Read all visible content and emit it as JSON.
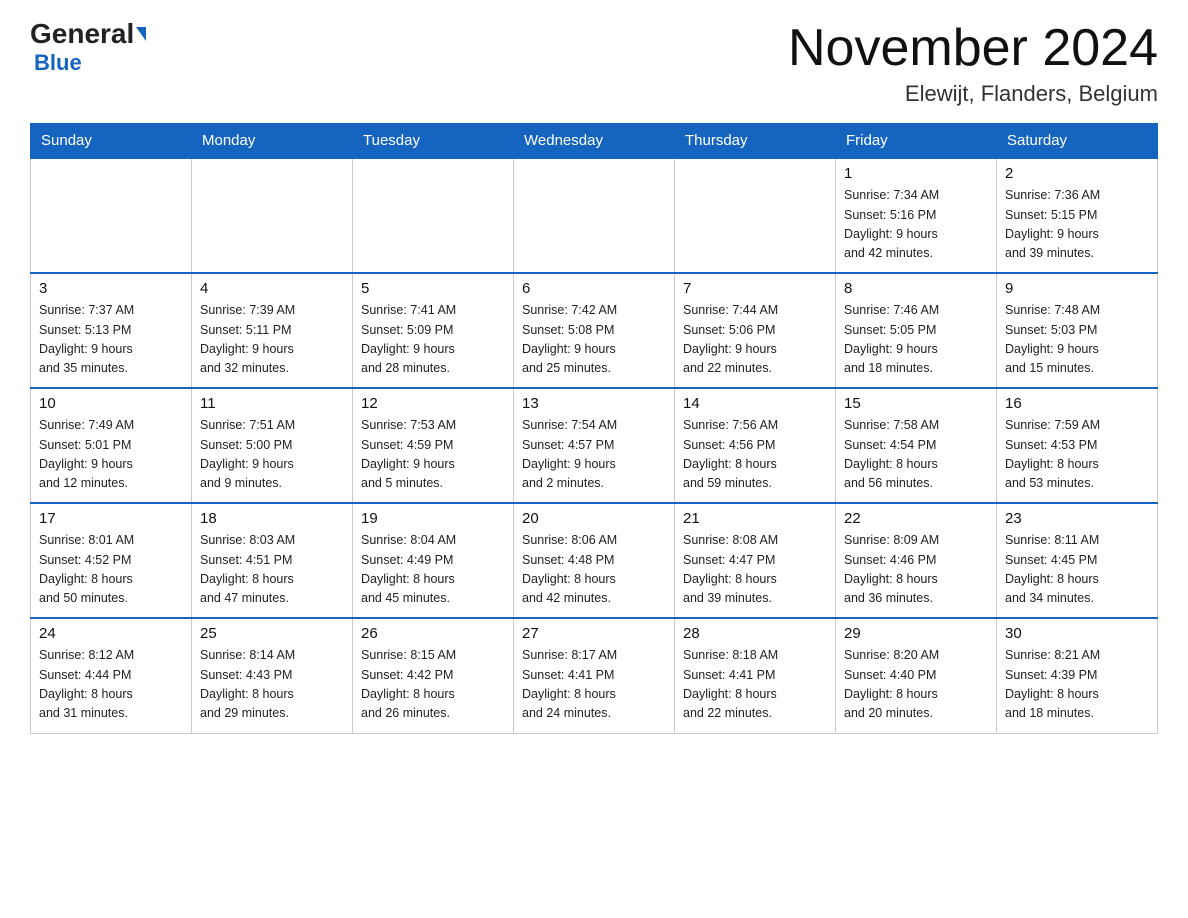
{
  "header": {
    "logo_general": "General",
    "logo_blue": "Blue",
    "month_year": "November 2024",
    "location": "Elewijt, Flanders, Belgium"
  },
  "days_of_week": [
    "Sunday",
    "Monday",
    "Tuesday",
    "Wednesday",
    "Thursday",
    "Friday",
    "Saturday"
  ],
  "weeks": [
    {
      "days": [
        {
          "num": "",
          "info": ""
        },
        {
          "num": "",
          "info": ""
        },
        {
          "num": "",
          "info": ""
        },
        {
          "num": "",
          "info": ""
        },
        {
          "num": "",
          "info": ""
        },
        {
          "num": "1",
          "info": "Sunrise: 7:34 AM\nSunset: 5:16 PM\nDaylight: 9 hours\nand 42 minutes."
        },
        {
          "num": "2",
          "info": "Sunrise: 7:36 AM\nSunset: 5:15 PM\nDaylight: 9 hours\nand 39 minutes."
        }
      ]
    },
    {
      "days": [
        {
          "num": "3",
          "info": "Sunrise: 7:37 AM\nSunset: 5:13 PM\nDaylight: 9 hours\nand 35 minutes."
        },
        {
          "num": "4",
          "info": "Sunrise: 7:39 AM\nSunset: 5:11 PM\nDaylight: 9 hours\nand 32 minutes."
        },
        {
          "num": "5",
          "info": "Sunrise: 7:41 AM\nSunset: 5:09 PM\nDaylight: 9 hours\nand 28 minutes."
        },
        {
          "num": "6",
          "info": "Sunrise: 7:42 AM\nSunset: 5:08 PM\nDaylight: 9 hours\nand 25 minutes."
        },
        {
          "num": "7",
          "info": "Sunrise: 7:44 AM\nSunset: 5:06 PM\nDaylight: 9 hours\nand 22 minutes."
        },
        {
          "num": "8",
          "info": "Sunrise: 7:46 AM\nSunset: 5:05 PM\nDaylight: 9 hours\nand 18 minutes."
        },
        {
          "num": "9",
          "info": "Sunrise: 7:48 AM\nSunset: 5:03 PM\nDaylight: 9 hours\nand 15 minutes."
        }
      ]
    },
    {
      "days": [
        {
          "num": "10",
          "info": "Sunrise: 7:49 AM\nSunset: 5:01 PM\nDaylight: 9 hours\nand 12 minutes."
        },
        {
          "num": "11",
          "info": "Sunrise: 7:51 AM\nSunset: 5:00 PM\nDaylight: 9 hours\nand 9 minutes."
        },
        {
          "num": "12",
          "info": "Sunrise: 7:53 AM\nSunset: 4:59 PM\nDaylight: 9 hours\nand 5 minutes."
        },
        {
          "num": "13",
          "info": "Sunrise: 7:54 AM\nSunset: 4:57 PM\nDaylight: 9 hours\nand 2 minutes."
        },
        {
          "num": "14",
          "info": "Sunrise: 7:56 AM\nSunset: 4:56 PM\nDaylight: 8 hours\nand 59 minutes."
        },
        {
          "num": "15",
          "info": "Sunrise: 7:58 AM\nSunset: 4:54 PM\nDaylight: 8 hours\nand 56 minutes."
        },
        {
          "num": "16",
          "info": "Sunrise: 7:59 AM\nSunset: 4:53 PM\nDaylight: 8 hours\nand 53 minutes."
        }
      ]
    },
    {
      "days": [
        {
          "num": "17",
          "info": "Sunrise: 8:01 AM\nSunset: 4:52 PM\nDaylight: 8 hours\nand 50 minutes."
        },
        {
          "num": "18",
          "info": "Sunrise: 8:03 AM\nSunset: 4:51 PM\nDaylight: 8 hours\nand 47 minutes."
        },
        {
          "num": "19",
          "info": "Sunrise: 8:04 AM\nSunset: 4:49 PM\nDaylight: 8 hours\nand 45 minutes."
        },
        {
          "num": "20",
          "info": "Sunrise: 8:06 AM\nSunset: 4:48 PM\nDaylight: 8 hours\nand 42 minutes."
        },
        {
          "num": "21",
          "info": "Sunrise: 8:08 AM\nSunset: 4:47 PM\nDaylight: 8 hours\nand 39 minutes."
        },
        {
          "num": "22",
          "info": "Sunrise: 8:09 AM\nSunset: 4:46 PM\nDaylight: 8 hours\nand 36 minutes."
        },
        {
          "num": "23",
          "info": "Sunrise: 8:11 AM\nSunset: 4:45 PM\nDaylight: 8 hours\nand 34 minutes."
        }
      ]
    },
    {
      "days": [
        {
          "num": "24",
          "info": "Sunrise: 8:12 AM\nSunset: 4:44 PM\nDaylight: 8 hours\nand 31 minutes."
        },
        {
          "num": "25",
          "info": "Sunrise: 8:14 AM\nSunset: 4:43 PM\nDaylight: 8 hours\nand 29 minutes."
        },
        {
          "num": "26",
          "info": "Sunrise: 8:15 AM\nSunset: 4:42 PM\nDaylight: 8 hours\nand 26 minutes."
        },
        {
          "num": "27",
          "info": "Sunrise: 8:17 AM\nSunset: 4:41 PM\nDaylight: 8 hours\nand 24 minutes."
        },
        {
          "num": "28",
          "info": "Sunrise: 8:18 AM\nSunset: 4:41 PM\nDaylight: 8 hours\nand 22 minutes."
        },
        {
          "num": "29",
          "info": "Sunrise: 8:20 AM\nSunset: 4:40 PM\nDaylight: 8 hours\nand 20 minutes."
        },
        {
          "num": "30",
          "info": "Sunrise: 8:21 AM\nSunset: 4:39 PM\nDaylight: 8 hours\nand 18 minutes."
        }
      ]
    }
  ]
}
